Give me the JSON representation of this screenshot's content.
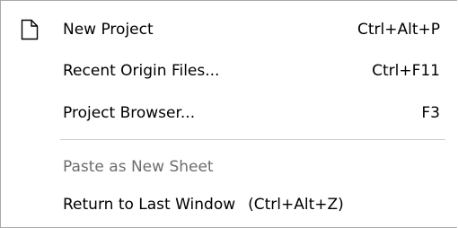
{
  "menu": {
    "items": [
      {
        "label": "New Project",
        "shortcut": "Ctrl+Alt+P",
        "icon": "new-document-icon"
      },
      {
        "label": "Recent Origin Files...",
        "shortcut": "Ctrl+F11"
      },
      {
        "label": "Project Browser...",
        "shortcut": "F3"
      },
      {
        "label": "Paste as New Sheet",
        "shortcut": "",
        "disabled": true
      },
      {
        "label": "Return to Last Window",
        "shortcut": "(Ctrl+Alt+Z)"
      }
    ]
  },
  "colors": {
    "text": "#000000",
    "disabled_text": "#6d6d6d",
    "border": "#a9a9a9",
    "separator": "#cfcfcf"
  }
}
